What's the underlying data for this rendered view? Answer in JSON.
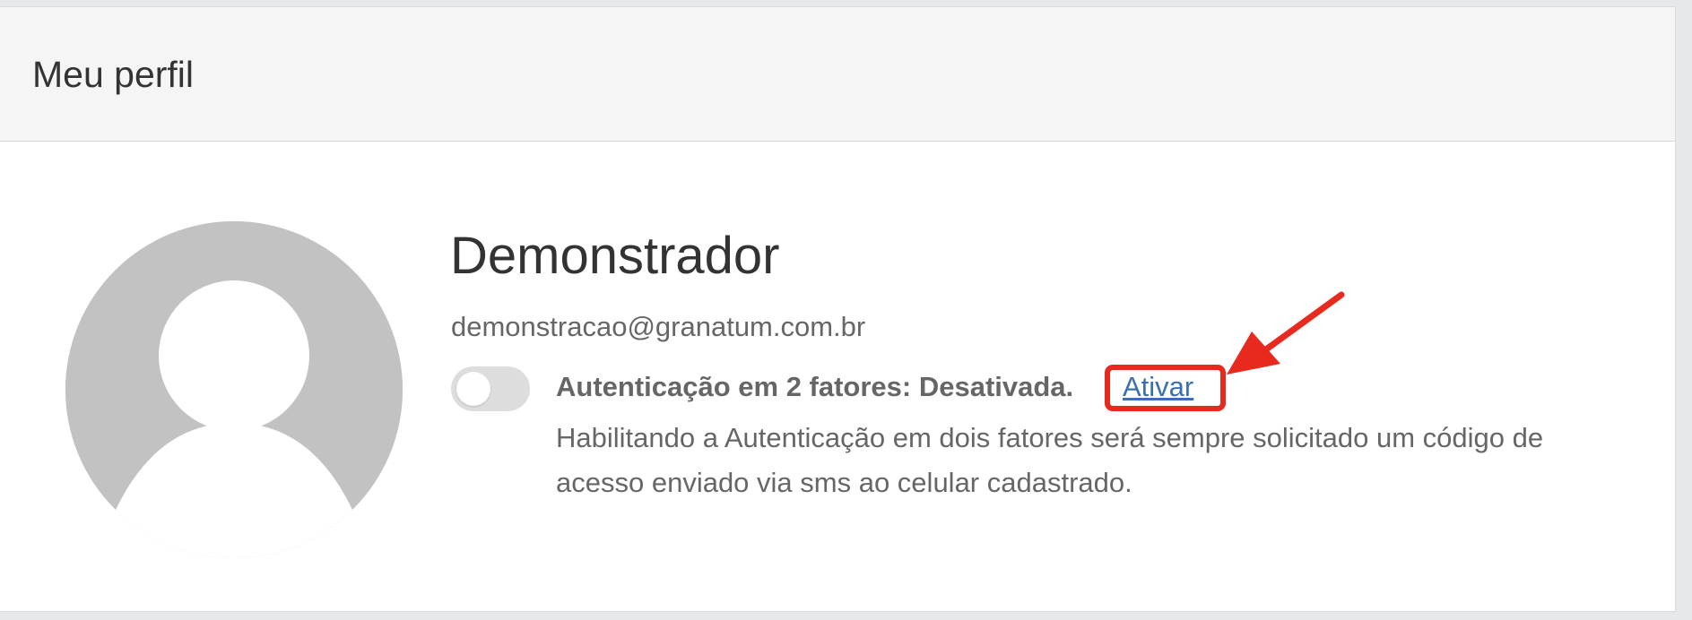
{
  "panel": {
    "title": "Meu perfil"
  },
  "profile": {
    "name": "Demonstrador",
    "email": "demonstracao@granatum.com.br",
    "avatar_icon": "default-user-avatar"
  },
  "two_factor": {
    "enabled": false,
    "status_text": "Autenticação em 2 fatores: Desativada.",
    "activate_label": "Ativar",
    "description": "Habilitando a Autenticação em dois fatores será sempre solicitado um código de acesso enviado via sms ao celular cadastrado."
  },
  "annotation": {
    "highlight_color": "#e8291e",
    "arrow_icon": "red-arrow-annotation"
  },
  "colors": {
    "link": "#3a6fb2",
    "toggle_off": "#dddddd"
  }
}
